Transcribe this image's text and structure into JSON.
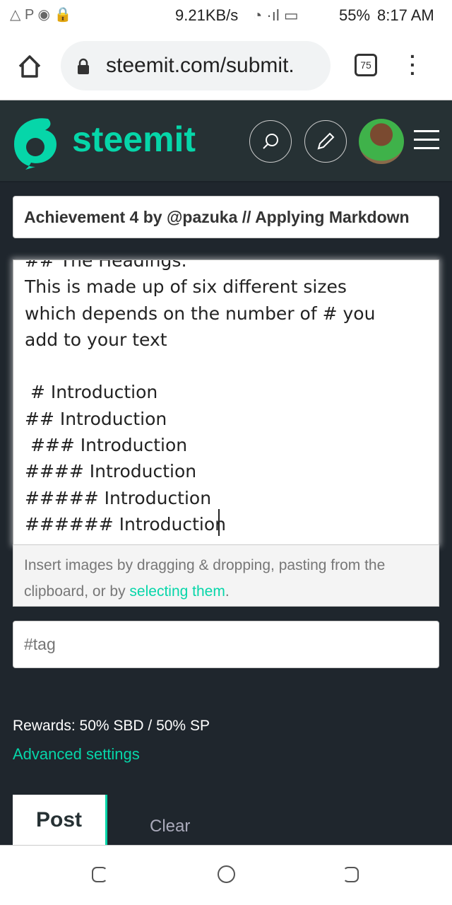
{
  "status_bar": {
    "network_speed": "9.21KB/s",
    "battery": "55%",
    "time": "8:17 AM"
  },
  "browser": {
    "url": "steemit.com/submit.",
    "tab_count": "75"
  },
  "header": {
    "brand": "steemit",
    "brand_color": "#06d6a9"
  },
  "editor": {
    "title_value": "Achievement 4 by  @pazuka // Applying Markdown",
    "body_lines": [
      "## The Headings:",
      "This is made up of six different sizes",
      "which depends on the number of # you",
      "add to your text",
      "",
      " # Introduction",
      "## Introduction",
      " ### Introduction",
      "#### Introduction",
      "##### Introduction",
      "###### Introduction"
    ],
    "help_text": "Insert images by dragging & dropping, pasting from the clipboard, or by ",
    "help_link": "selecting them",
    "help_end": ".",
    "tag_placeholder": "#tag"
  },
  "rewards": "Rewards: 50% SBD / 50% SP",
  "advanced_settings": "Advanced settings",
  "actions": {
    "post": "Post",
    "clear": "Clear"
  }
}
